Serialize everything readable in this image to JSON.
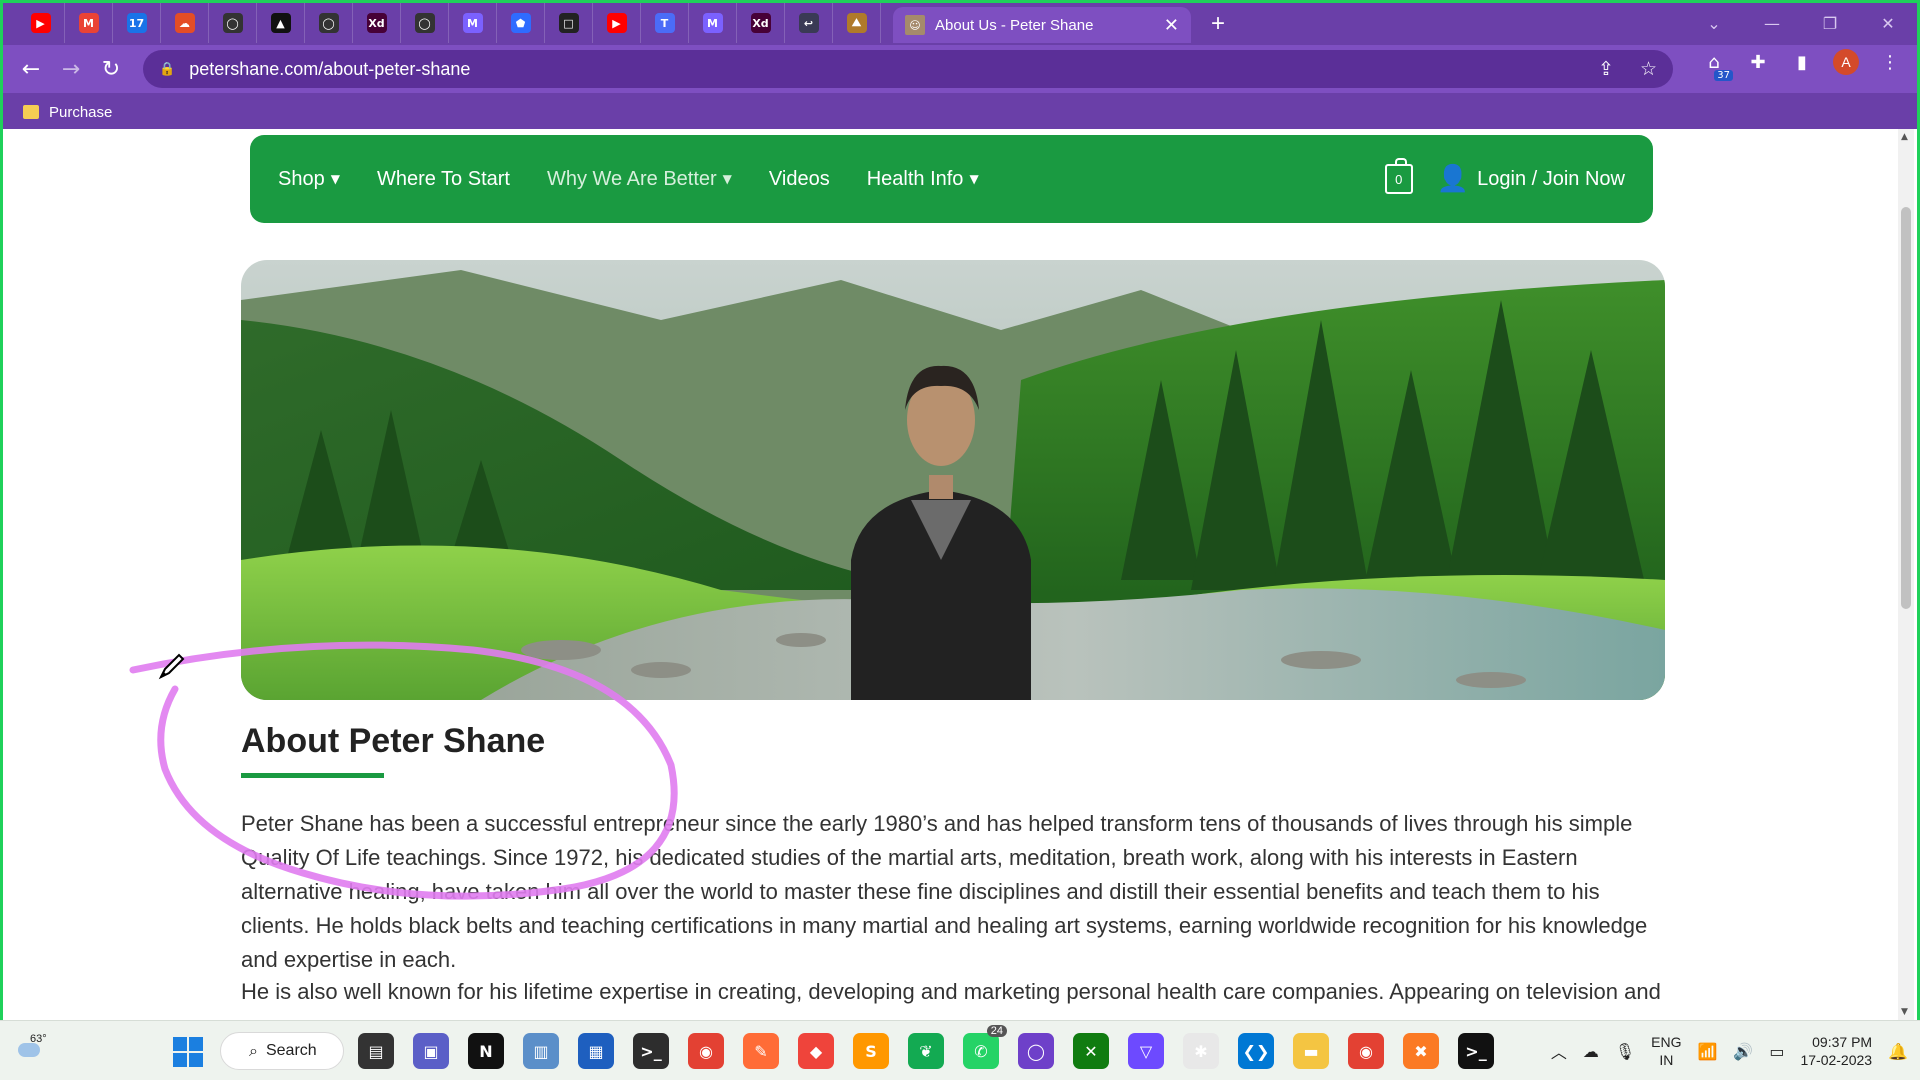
{
  "browser": {
    "active_tab_title": "About Us - Peter Shane",
    "new_tab_label": "+",
    "address_url": "petershane.com/about-peter-shane",
    "extension_badge": "37",
    "profile_initial": "A",
    "bookmark_label": "Purchase",
    "pinned_tabs": [
      {
        "icon": "youtube-icon",
        "color": "#ff0000",
        "glyph": "▶"
      },
      {
        "icon": "gmail-icon",
        "color": "#ea4335",
        "glyph": "M"
      },
      {
        "icon": "calendar-icon",
        "color": "#1a73e8",
        "glyph": "17"
      },
      {
        "icon": "cloud-app-icon",
        "color": "#e44d26",
        "glyph": "☁"
      },
      {
        "icon": "github-icon",
        "color": "#333333",
        "glyph": "◯"
      },
      {
        "icon": "triangle-app-icon",
        "color": "#111111",
        "glyph": "▲"
      },
      {
        "icon": "github-icon",
        "color": "#333333",
        "glyph": "◯"
      },
      {
        "icon": "adobe-xd-icon",
        "color": "#470137",
        "glyph": "Xd"
      },
      {
        "icon": "github-icon",
        "color": "#333333",
        "glyph": "◯"
      },
      {
        "icon": "mail-m-icon",
        "color": "#7b61ff",
        "glyph": "M"
      },
      {
        "icon": "shield-blue-icon",
        "color": "#2f6bff",
        "glyph": "⬟"
      },
      {
        "icon": "square-app-icon",
        "color": "#222222",
        "glyph": "□"
      },
      {
        "icon": "youtube-icon",
        "color": "#ff0000",
        "glyph": "▶"
      },
      {
        "icon": "teams-icon",
        "color": "#4b6cf7",
        "glyph": "T"
      },
      {
        "icon": "mail-m-icon",
        "color": "#7b61ff",
        "glyph": "M"
      },
      {
        "icon": "adobe-xd-icon",
        "color": "#470137",
        "glyph": "Xd"
      },
      {
        "icon": "arrow-app-icon",
        "color": "#3a3a55",
        "glyph": "↩"
      },
      {
        "icon": "mountain-app-icon",
        "color": "#b07a2a",
        "glyph": "⛰"
      }
    ]
  },
  "site": {
    "nav": {
      "shop": "Shop",
      "where_to_start": "Where To Start",
      "why_we_are_better": "Why We Are Better",
      "videos": "Videos",
      "health_info": "Health Info",
      "cart_count": "0",
      "login": "Login / Join Now"
    },
    "heading": "About Peter Shane",
    "paragraphs": [
      "Peter Shane has been a successful entrepreneur since the early 1980’s and has helped transform tens of thousands of lives through his simple Quality Of Life teachings. Since 1972, his dedicated studies of the martial arts, meditation, breath work, along with his interests in Eastern alternative healing, have taken him all over the world to master these fine disciplines and distill their essential benefits and teach them to his clients. He holds black belts and teaching certifications in many martial and healing art systems, earning worldwide recognition for his knowledge and expertise in each.",
      "He is also well known for his lifetime expertise in creating, developing and marketing personal health care companies. Appearing on television and"
    ],
    "accent_color": "#1a9a41"
  },
  "taskbar": {
    "temperature": "63°",
    "search_label": "Search",
    "apps": [
      {
        "icon": "file-explorer-dark-icon",
        "color": "#333333",
        "glyph": "▤"
      },
      {
        "icon": "teams-chat-icon",
        "color": "#5b5fc7",
        "glyph": "▣"
      },
      {
        "icon": "notion-icon",
        "color": "#111111",
        "glyph": "N"
      },
      {
        "icon": "monitor-app-icon",
        "color": "#5b8fc9",
        "glyph": "▥"
      },
      {
        "icon": "store-icon",
        "color": "#1e5fbf",
        "glyph": "▦"
      },
      {
        "icon": "terminal-icon",
        "color": "#2d2d2d",
        "glyph": ">_"
      },
      {
        "icon": "chrome-icon",
        "color": "#e34133",
        "glyph": "◉"
      },
      {
        "icon": "postman-icon",
        "color": "#ff6c37",
        "glyph": "✎"
      },
      {
        "icon": "anydesk-icon",
        "color": "#ef443b",
        "glyph": "◆"
      },
      {
        "icon": "sublime-icon",
        "color": "#ff9800",
        "glyph": "S"
      },
      {
        "icon": "mongodb-icon",
        "color": "#13aa52",
        "glyph": "❦"
      },
      {
        "icon": "whatsapp-icon",
        "color": "#25d366",
        "glyph": "✆",
        "badge": "24"
      },
      {
        "icon": "github-desktop-icon",
        "color": "#6e40c9",
        "glyph": "◯"
      },
      {
        "icon": "xbox-icon",
        "color": "#107c10",
        "glyph": "✕"
      },
      {
        "icon": "proton-vpn-icon",
        "color": "#6d4aff",
        "glyph": "▽"
      },
      {
        "icon": "slack-icon",
        "color": "#e8e8e8",
        "glyph": "✱"
      },
      {
        "icon": "vscode-icon",
        "color": "#0078d4",
        "glyph": "❮❯"
      },
      {
        "icon": "folder-icon",
        "color": "#f4c542",
        "glyph": "▬"
      },
      {
        "icon": "chrome-profile-icon",
        "color": "#e34133",
        "glyph": "◉"
      },
      {
        "icon": "xampp-icon",
        "color": "#fb7a24",
        "glyph": "✖"
      },
      {
        "icon": "cmd-icon",
        "color": "#111111",
        "glyph": ">_"
      }
    ],
    "lang_top": "ENG",
    "lang_bottom": "IN",
    "time": "09:37 PM",
    "date": "17-02-2023"
  }
}
